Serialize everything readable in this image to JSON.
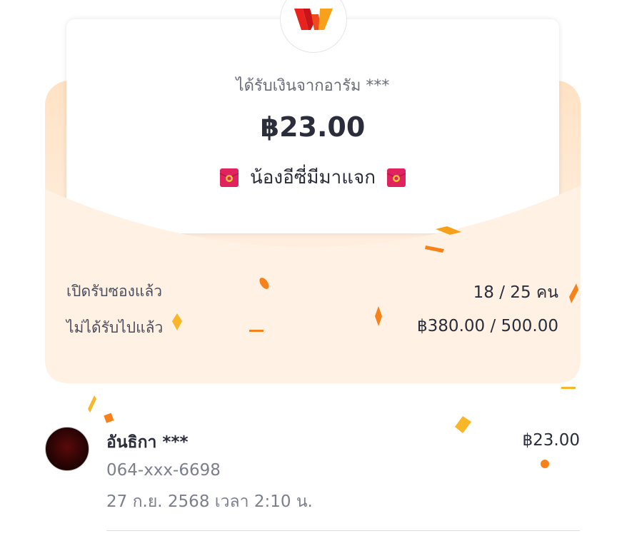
{
  "logo": {
    "icon": "wallet-w-logo",
    "colors": [
      "#e8231e",
      "#f7a11a"
    ]
  },
  "packet": {
    "sender_text": "ได้รับเงินจากอารัม ***",
    "amount": "฿23.00",
    "message": "น้องอีซี่มีมาแจก",
    "message_icon": "red-envelope-icon"
  },
  "stats": {
    "opened_label": "เปิดรับซองแล้ว",
    "opened_value": "18 / 25 คน",
    "remaining_label": "ไม่ได้รับไปแล้ว",
    "remaining_value": "฿380.00 / 500.00"
  },
  "claimers": [
    {
      "name": "อันธิกา ***",
      "phone": "064-xxx-6698",
      "time": "27 ก.ย. 2568 เวลา 2:10 น.",
      "amount": "฿23.00"
    }
  ],
  "colors": {
    "envelope": "#ffeede",
    "confetti_orange": "#f7821b",
    "confetti_yellow": "#f9b628"
  }
}
